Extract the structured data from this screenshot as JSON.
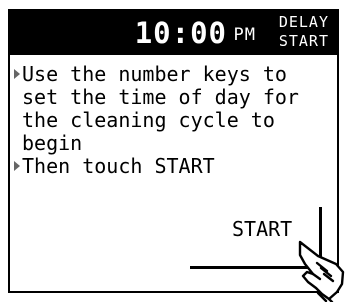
{
  "header": {
    "time": "10:00",
    "ampm": "PM",
    "mode_line1": "DELAY",
    "mode_line2": "START"
  },
  "instructions": [
    {
      "text": "Use the number keys to\nset the time of day for\nthe cleaning cycle to\nbegin"
    },
    {
      "text": "Then touch START"
    }
  ],
  "start_button": {
    "label": "START"
  },
  "icons": {
    "bullet": "triangle-bullet-icon",
    "pointer": "pointing-hand-icon"
  },
  "colors": {
    "header_bg": "#000000",
    "header_text": "#ffffff",
    "bullet": "#666666"
  }
}
